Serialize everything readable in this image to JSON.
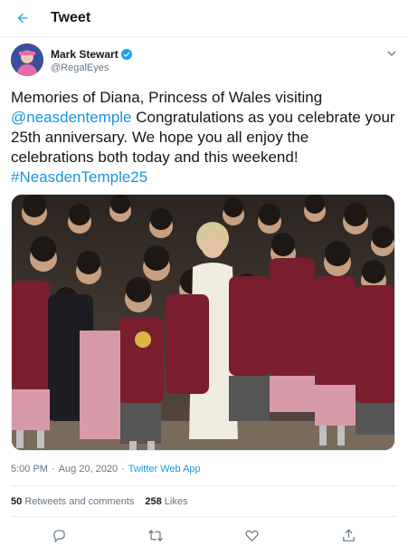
{
  "header": {
    "title": "Tweet",
    "back_icon": "arrow-left-icon"
  },
  "author": {
    "name": "Mark Stewart",
    "handle": "@RegalEyes",
    "verified_icon": "verified-badge-icon",
    "menu_icon": "chevron-down-icon"
  },
  "tweet": {
    "text_1": "Memories of Diana, Princess of Wales visiting ",
    "mention": "@neasdentemple",
    "text_2": "  Congratulations as you celebrate your 25th anniversary. We hope you all enjoy the celebrations both today and this weekend! ",
    "hashtag": "#NeasdenTemple25"
  },
  "meta": {
    "time": "5:00 PM",
    "separator": "·",
    "date": "Aug 20, 2020",
    "client": "Twitter Web App"
  },
  "stats": {
    "retweets_count": "50",
    "retweets_label": "Retweets and comments",
    "likes_count": "258",
    "likes_label": "Likes"
  },
  "actions": [
    "reply-icon",
    "retweet-icon",
    "like-icon",
    "share-icon"
  ],
  "colors": {
    "accent": "#1da1f2",
    "link": "#1b95e0",
    "text": "#14171a",
    "muted": "#657786",
    "border": "#e6ecf0"
  }
}
